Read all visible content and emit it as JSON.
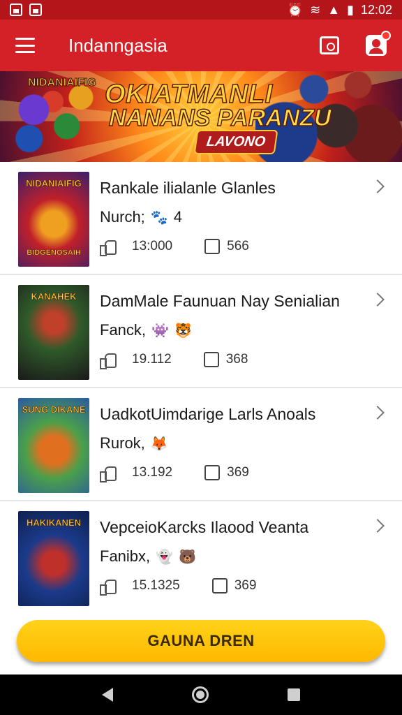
{
  "status_bar": {
    "time": "12:02",
    "icons": [
      "notification-icon",
      "image-icon",
      "alarm-icon",
      "wifi-icon",
      "signal-icon",
      "battery-icon"
    ]
  },
  "app_bar": {
    "title": "Indanngasia",
    "icons": [
      "menu-icon",
      "camera-icon",
      "profile-icon"
    ]
  },
  "banner": {
    "small_text": "NIDANIAIFIG",
    "title": "OKIATMANLI",
    "subtitle": "NANANS PARANZU",
    "pill": "LAVONO"
  },
  "games": [
    {
      "title": "Rankale ilialanle Glanles",
      "subtitle": "Nurch;",
      "subtitle_extra": "4",
      "likes": "13:000",
      "comments": "566",
      "thumb_top": "NIDANIAIFIG",
      "thumb_bottom": "BIDGENOSAIH",
      "colors": [
        "#f0a020",
        "#c0202a",
        "#3a1f6a"
      ]
    },
    {
      "title": "DamMale Faunuan Nay Senialian",
      "subtitle": "Fanck,",
      "subtitle_extra": "",
      "likes": "19.112",
      "comments": "368",
      "thumb_top": "KANAHEK",
      "thumb_bottom": "",
      "colors": [
        "#1a1a1a",
        "#2f5a2a",
        "#c0402a"
      ]
    },
    {
      "title": "UadkotUimdarige Larls Anoals",
      "subtitle": "Rurok,",
      "subtitle_extra": "",
      "likes": "13.192",
      "comments": "369",
      "thumb_top": "SUNG DIKANE",
      "thumb_bottom": "",
      "colors": [
        "#4aa04a",
        "#e07020",
        "#2a5aa0"
      ]
    },
    {
      "title": "VepceioKarcks Ilaood Veanta",
      "subtitle": "Fanibx,",
      "subtitle_extra": "",
      "likes": "15.1325",
      "comments": "369",
      "thumb_top": "HAKIKANEN",
      "thumb_bottom": "",
      "colors": [
        "#1a3a8a",
        "#c0302a",
        "#102050"
      ]
    }
  ],
  "cta": {
    "label": "GAUNA DREN"
  },
  "nav": {
    "icons": [
      "back-icon",
      "home-icon",
      "recents-icon"
    ]
  }
}
